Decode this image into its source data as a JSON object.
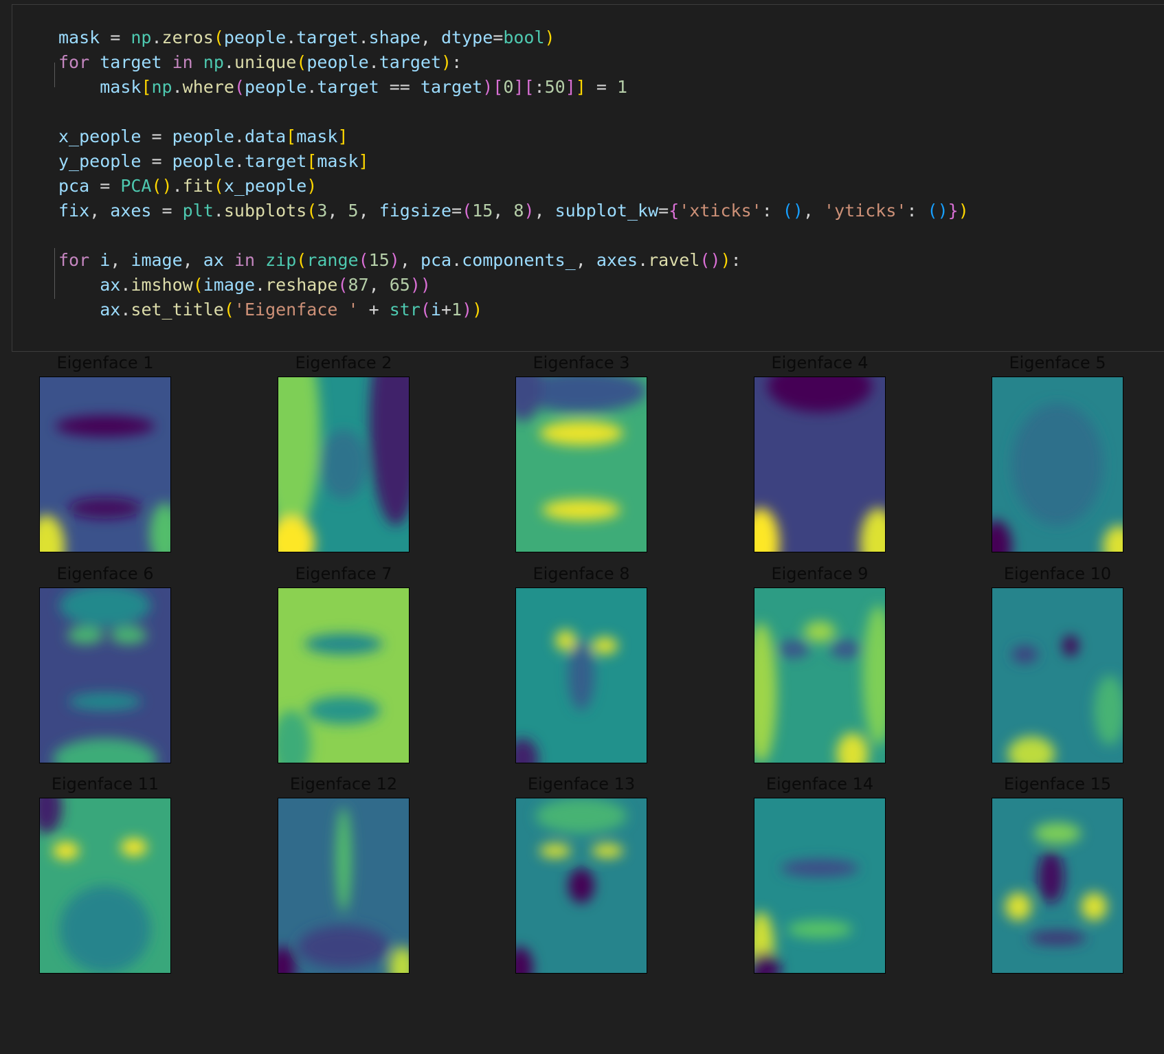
{
  "code": {
    "lines": [
      [
        [
          "v",
          "mask"
        ],
        [
          "o",
          " = "
        ],
        [
          "t",
          "np"
        ],
        [
          "o",
          "."
        ],
        [
          "f",
          "zeros"
        ],
        [
          "y",
          "("
        ],
        [
          "v",
          "people"
        ],
        [
          "o",
          "."
        ],
        [
          "v",
          "target"
        ],
        [
          "o",
          "."
        ],
        [
          "v",
          "shape"
        ],
        [
          "o",
          ", "
        ],
        [
          "v",
          "dtype"
        ],
        [
          "o",
          "="
        ],
        [
          "t",
          "bool"
        ],
        [
          "y",
          ")"
        ]
      ],
      [
        [
          "k",
          "for"
        ],
        [
          "o",
          " "
        ],
        [
          "v",
          "target"
        ],
        [
          "o",
          " "
        ],
        [
          "k",
          "in"
        ],
        [
          "o",
          " "
        ],
        [
          "t",
          "np"
        ],
        [
          "o",
          "."
        ],
        [
          "f",
          "unique"
        ],
        [
          "y",
          "("
        ],
        [
          "v",
          "people"
        ],
        [
          "o",
          "."
        ],
        [
          "v",
          "target"
        ],
        [
          "y",
          ")"
        ],
        [
          "o",
          ":"
        ]
      ],
      [
        [
          "o",
          "    "
        ],
        [
          "v",
          "mask"
        ],
        [
          "y",
          "["
        ],
        [
          "t",
          "np"
        ],
        [
          "o",
          "."
        ],
        [
          "f",
          "where"
        ],
        [
          "p",
          "("
        ],
        [
          "v",
          "people"
        ],
        [
          "o",
          "."
        ],
        [
          "v",
          "target"
        ],
        [
          "o",
          " == "
        ],
        [
          "v",
          "target"
        ],
        [
          "p",
          ")"
        ],
        [
          "p",
          "["
        ],
        [
          "n",
          "0"
        ],
        [
          "p",
          "]"
        ],
        [
          "p",
          "["
        ],
        [
          "o",
          ":"
        ],
        [
          "n",
          "50"
        ],
        [
          "p",
          "]"
        ],
        [
          "y",
          "]"
        ],
        [
          "o",
          " = "
        ],
        [
          "n",
          "1"
        ]
      ],
      [],
      [
        [
          "v",
          "x_people"
        ],
        [
          "o",
          " = "
        ],
        [
          "v",
          "people"
        ],
        [
          "o",
          "."
        ],
        [
          "v",
          "data"
        ],
        [
          "y",
          "["
        ],
        [
          "v",
          "mask"
        ],
        [
          "y",
          "]"
        ]
      ],
      [
        [
          "v",
          "y_people"
        ],
        [
          "o",
          " = "
        ],
        [
          "v",
          "people"
        ],
        [
          "o",
          "."
        ],
        [
          "v",
          "target"
        ],
        [
          "y",
          "["
        ],
        [
          "v",
          "mask"
        ],
        [
          "y",
          "]"
        ]
      ],
      [
        [
          "v",
          "pca"
        ],
        [
          "o",
          " = "
        ],
        [
          "t",
          "PCA"
        ],
        [
          "y",
          "()"
        ],
        [
          "o",
          "."
        ],
        [
          "f",
          "fit"
        ],
        [
          "y",
          "("
        ],
        [
          "v",
          "x_people"
        ],
        [
          "y",
          ")"
        ]
      ],
      [
        [
          "v",
          "fix"
        ],
        [
          "o",
          ", "
        ],
        [
          "v",
          "axes"
        ],
        [
          "o",
          " = "
        ],
        [
          "t",
          "plt"
        ],
        [
          "o",
          "."
        ],
        [
          "f",
          "subplots"
        ],
        [
          "y",
          "("
        ],
        [
          "n",
          "3"
        ],
        [
          "o",
          ", "
        ],
        [
          "n",
          "5"
        ],
        [
          "o",
          ", "
        ],
        [
          "v",
          "figsize"
        ],
        [
          "o",
          "="
        ],
        [
          "p",
          "("
        ],
        [
          "n",
          "15"
        ],
        [
          "o",
          ", "
        ],
        [
          "n",
          "8"
        ],
        [
          "p",
          ")"
        ],
        [
          "o",
          ", "
        ],
        [
          "v",
          "subplot_kw"
        ],
        [
          "o",
          "="
        ],
        [
          "p",
          "{"
        ],
        [
          "s",
          "'xticks'"
        ],
        [
          "o",
          ": "
        ],
        [
          "b",
          "()"
        ],
        [
          "o",
          ", "
        ],
        [
          "s",
          "'yticks'"
        ],
        [
          "o",
          ": "
        ],
        [
          "b",
          "()"
        ],
        [
          "p",
          "}"
        ],
        [
          "y",
          ")"
        ]
      ],
      [],
      [
        [
          "k",
          "for"
        ],
        [
          "o",
          " "
        ],
        [
          "v",
          "i"
        ],
        [
          "o",
          ", "
        ],
        [
          "v",
          "image"
        ],
        [
          "o",
          ", "
        ],
        [
          "v",
          "ax"
        ],
        [
          "o",
          " "
        ],
        [
          "k",
          "in"
        ],
        [
          "o",
          " "
        ],
        [
          "t",
          "zip"
        ],
        [
          "y",
          "("
        ],
        [
          "t",
          "range"
        ],
        [
          "p",
          "("
        ],
        [
          "n",
          "15"
        ],
        [
          "p",
          ")"
        ],
        [
          "o",
          ", "
        ],
        [
          "v",
          "pca"
        ],
        [
          "o",
          "."
        ],
        [
          "v",
          "components_"
        ],
        [
          "o",
          ", "
        ],
        [
          "v",
          "axes"
        ],
        [
          "o",
          "."
        ],
        [
          "f",
          "ravel"
        ],
        [
          "p",
          "()"
        ],
        [
          "y",
          ")"
        ],
        [
          "o",
          ":"
        ]
      ],
      [
        [
          "o",
          "    "
        ],
        [
          "v",
          "ax"
        ],
        [
          "o",
          "."
        ],
        [
          "f",
          "imshow"
        ],
        [
          "y",
          "("
        ],
        [
          "v",
          "image"
        ],
        [
          "o",
          "."
        ],
        [
          "f",
          "reshape"
        ],
        [
          "p",
          "("
        ],
        [
          "n",
          "87"
        ],
        [
          "o",
          ", "
        ],
        [
          "n",
          "65"
        ],
        [
          "p",
          "))"
        ],
        [
          "y",
          ""
        ]
      ],
      [
        [
          "o",
          "    "
        ],
        [
          "v",
          "ax"
        ],
        [
          "o",
          "."
        ],
        [
          "f",
          "set_title"
        ],
        [
          "y",
          "("
        ],
        [
          "s",
          "'Eigenface '"
        ],
        [
          "o",
          " + "
        ],
        [
          "t",
          "str"
        ],
        [
          "p",
          "("
        ],
        [
          "v",
          "i"
        ],
        [
          "o",
          "+"
        ],
        [
          "n",
          "1"
        ],
        [
          "p",
          ")"
        ],
        [
          "y",
          ")"
        ]
      ]
    ]
  },
  "output": {
    "colormap": [
      "#440154",
      "#3b528b",
      "#21918c",
      "#5ec962",
      "#fde725"
    ],
    "panels": [
      {
        "title": "Eigenface 1",
        "base": 0.25,
        "tone": 0.25,
        "spots": [
          [
            0.5,
            0.28,
            0.38,
            0.06,
            -0.25
          ],
          [
            0.5,
            0.75,
            0.28,
            0.06,
            -0.2
          ],
          [
            0.05,
            0.97,
            0.14,
            0.18,
            0.7
          ],
          [
            0.96,
            0.9,
            0.12,
            0.18,
            0.45
          ]
        ]
      },
      {
        "title": "Eigenface 2",
        "base": 0.5,
        "tone": 0.25,
        "spots": [
          [
            0.1,
            0.3,
            0.22,
            0.6,
            0.3
          ],
          [
            0.9,
            0.25,
            0.2,
            0.6,
            -0.4
          ],
          [
            0.1,
            0.95,
            0.18,
            0.15,
            0.6
          ],
          [
            0.5,
            0.5,
            0.18,
            0.2,
            -0.12
          ]
        ]
      },
      {
        "title": "Eigenface 3",
        "base": 0.62,
        "tone": 0.25,
        "spots": [
          [
            0.5,
            0.32,
            0.32,
            0.07,
            0.35
          ],
          [
            0.5,
            0.76,
            0.3,
            0.06,
            0.35
          ],
          [
            0.5,
            0.08,
            0.5,
            0.12,
            -0.35
          ],
          [
            0.05,
            0.05,
            0.15,
            0.2,
            -0.4
          ]
        ]
      },
      {
        "title": "Eigenface 4",
        "base": 0.2,
        "tone": 0.25,
        "spots": [
          [
            0.5,
            0.05,
            0.4,
            0.15,
            -0.2
          ],
          [
            0.05,
            0.95,
            0.14,
            0.2,
            0.8
          ],
          [
            0.95,
            0.95,
            0.14,
            0.2,
            0.75
          ]
        ]
      },
      {
        "title": "Eigenface 5",
        "base": 0.45,
        "tone": 0.25,
        "spots": [
          [
            0.03,
            0.97,
            0.12,
            0.15,
            -0.45
          ],
          [
            0.97,
            0.97,
            0.12,
            0.12,
            0.5
          ],
          [
            0.5,
            0.5,
            0.35,
            0.35,
            -0.08
          ]
        ]
      },
      {
        "title": "Eigenface 6",
        "base": 0.22,
        "tone": 0.25,
        "spots": [
          [
            0.35,
            0.27,
            0.14,
            0.05,
            0.45
          ],
          [
            0.68,
            0.27,
            0.14,
            0.05,
            0.45
          ],
          [
            0.5,
            0.65,
            0.28,
            0.05,
            0.25
          ],
          [
            0.5,
            0.1,
            0.35,
            0.12,
            0.25
          ],
          [
            0.5,
            0.98,
            0.4,
            0.12,
            0.4
          ]
        ]
      },
      {
        "title": "Eigenface 7",
        "base": 0.82,
        "tone": 0.25,
        "spots": [
          [
            0.5,
            0.32,
            0.3,
            0.06,
            -0.35
          ],
          [
            0.5,
            0.7,
            0.28,
            0.08,
            -0.3
          ],
          [
            0.1,
            0.9,
            0.15,
            0.2,
            -0.2
          ]
        ]
      },
      {
        "title": "Eigenface 8",
        "base": 0.5,
        "tone": 0.25,
        "spots": [
          [
            0.38,
            0.3,
            0.08,
            0.06,
            0.45
          ],
          [
            0.68,
            0.33,
            0.1,
            0.05,
            0.45
          ],
          [
            0.5,
            0.5,
            0.1,
            0.2,
            -0.2
          ],
          [
            0.05,
            0.98,
            0.12,
            0.12,
            -0.4
          ]
        ]
      },
      {
        "title": "Eigenface 9",
        "base": 0.55,
        "tone": 0.25,
        "spots": [
          [
            0.5,
            0.25,
            0.12,
            0.06,
            0.3
          ],
          [
            0.3,
            0.35,
            0.12,
            0.05,
            -0.3
          ],
          [
            0.7,
            0.35,
            0.12,
            0.05,
            -0.3
          ],
          [
            0.05,
            0.6,
            0.12,
            0.4,
            0.3
          ],
          [
            0.95,
            0.5,
            0.12,
            0.4,
            0.25
          ],
          [
            0.75,
            0.95,
            0.12,
            0.12,
            0.4
          ]
        ]
      },
      {
        "title": "Eigenface 10",
        "base": 0.45,
        "tone": 0.25,
        "spots": [
          [
            0.6,
            0.33,
            0.06,
            0.06,
            -0.55
          ],
          [
            0.25,
            0.38,
            0.1,
            0.05,
            -0.25
          ],
          [
            0.3,
            0.95,
            0.18,
            0.1,
            0.45
          ],
          [
            0.9,
            0.7,
            0.12,
            0.2,
            0.2
          ]
        ]
      },
      {
        "title": "Eigenface 11",
        "base": 0.6,
        "tone": 0.25,
        "spots": [
          [
            0.2,
            0.3,
            0.1,
            0.05,
            0.4
          ],
          [
            0.72,
            0.28,
            0.1,
            0.05,
            0.4
          ],
          [
            0.05,
            0.05,
            0.12,
            0.15,
            -0.5
          ],
          [
            0.5,
            0.75,
            0.35,
            0.25,
            -0.15
          ]
        ]
      },
      {
        "title": "Eigenface 12",
        "base": 0.35,
        "tone": 0.25,
        "spots": [
          [
            0.5,
            0.35,
            0.06,
            0.3,
            0.35
          ],
          [
            0.5,
            0.85,
            0.35,
            0.12,
            -0.15
          ],
          [
            0.95,
            0.97,
            0.1,
            0.12,
            0.55
          ],
          [
            0.03,
            0.97,
            0.1,
            0.12,
            -0.4
          ]
        ]
      },
      {
        "title": "Eigenface 13",
        "base": 0.45,
        "tone": 0.25,
        "spots": [
          [
            0.3,
            0.3,
            0.12,
            0.04,
            0.5
          ],
          [
            0.7,
            0.3,
            0.12,
            0.04,
            0.5
          ],
          [
            0.5,
            0.5,
            0.1,
            0.1,
            -0.45
          ],
          [
            0.5,
            0.1,
            0.35,
            0.1,
            0.2
          ],
          [
            0.03,
            0.97,
            0.1,
            0.12,
            -0.45
          ]
        ]
      },
      {
        "title": "Eigenface 14",
        "base": 0.48,
        "tone": 0.25,
        "spots": [
          [
            0.5,
            0.4,
            0.3,
            0.05,
            -0.25
          ],
          [
            0.05,
            0.85,
            0.1,
            0.2,
            0.45
          ],
          [
            0.5,
            0.75,
            0.25,
            0.05,
            0.25
          ],
          [
            0.08,
            0.98,
            0.12,
            0.1,
            -0.45
          ]
        ]
      },
      {
        "title": "Eigenface 15",
        "base": 0.45,
        "tone": 0.25,
        "spots": [
          [
            0.2,
            0.62,
            0.1,
            0.08,
            0.5
          ],
          [
            0.78,
            0.62,
            0.1,
            0.08,
            0.5
          ],
          [
            0.45,
            0.45,
            0.1,
            0.15,
            -0.4
          ],
          [
            0.5,
            0.2,
            0.18,
            0.06,
            0.35
          ],
          [
            0.5,
            0.8,
            0.22,
            0.04,
            -0.3
          ]
        ]
      }
    ]
  }
}
